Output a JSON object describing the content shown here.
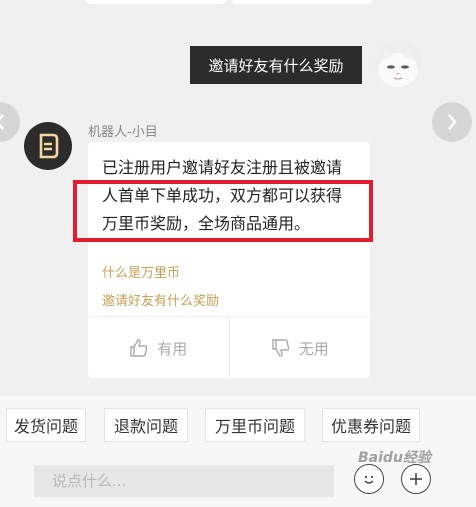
{
  "colors": {
    "background": "#f0f0f0",
    "user_bubble": "#2b2b2b",
    "link": "#c79f55",
    "highlight": "#e11d2f"
  },
  "user_message": {
    "text": "邀请好友有什么奖励"
  },
  "bot": {
    "name": "机器人-小目",
    "avatar_icon": "robot-logo-icon",
    "answer_lines": [
      "已注册用户邀请好友注册且被邀请",
      "人首单下单成功，双方都可以获得",
      "万里币奖励，全场商品通用。"
    ],
    "links": [
      "什么是万里币",
      "邀请好友有什么奖励"
    ],
    "feedback": {
      "helpful_label": "有用",
      "helpful_icon": "thumbs-up-icon",
      "unhelpful_label": "无用",
      "unhelpful_icon": "thumbs-down-icon"
    }
  },
  "quick_replies": [
    "发货问题",
    "退款问题",
    "万里币问题",
    "优惠券问题"
  ],
  "input": {
    "placeholder": "说点什么..."
  },
  "watermark": "Baidu经验"
}
